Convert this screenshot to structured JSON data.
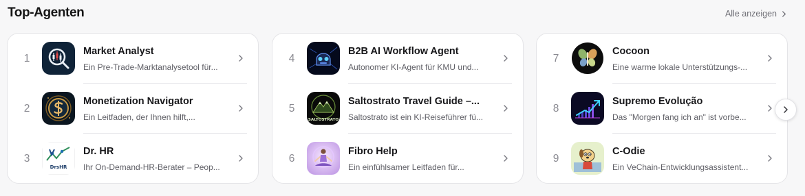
{
  "section": {
    "title": "Top-Agenten",
    "see_all": "Alle anzeigen"
  },
  "agents": [
    {
      "rank": "1",
      "name": "Market Analyst",
      "description": "Ein Pre-Trade-Marktanalysetool für...",
      "icon": "market-analyst-icon"
    },
    {
      "rank": "2",
      "name": "Monetization Navigator",
      "description": "Ein Leitfaden, der Ihnen hilft,...",
      "icon": "dollar-coin-icon"
    },
    {
      "rank": "3",
      "name": "Dr. HR",
      "description": "Ihr On-Demand-HR-Berater – Peop...",
      "icon": "dr-hr-logo-icon"
    },
    {
      "rank": "4",
      "name": "B2B AI Workflow Agent",
      "description": "Autonomer KI-Agent für KMU und...",
      "icon": "robot-head-icon"
    },
    {
      "rank": "5",
      "name": "Saltostrato Travel Guide –...",
      "description": "Saltostrato ist ein KI-Reiseführer fü...",
      "icon": "saltostrato-mountain-icon",
      "logo_text": "SALTOSTRATO"
    },
    {
      "rank": "6",
      "name": "Fibro Help",
      "description": "Ein einfühlsamer Leitfaden für...",
      "icon": "meditation-figure-icon"
    },
    {
      "rank": "7",
      "name": "Cocoon",
      "description": "Eine warme lokale Unterstützungs-...",
      "icon": "butterfly-icon"
    },
    {
      "rank": "8",
      "name": "Supremo Evolução",
      "description": "Das \"Morgen fang ich an\" ist vorbe...",
      "icon": "rising-chart-icon"
    },
    {
      "rank": "9",
      "name": "C-Odie",
      "description": "Ein VeChain-Entwicklungsassistent...",
      "icon": "cartoon-dog-icon"
    }
  ],
  "colors": {
    "background": "#f7f7f8",
    "card": "#ffffff",
    "border": "#e4e4e7",
    "rank": "#8a8a91",
    "name": "#17171a",
    "description": "#5f5f66"
  }
}
